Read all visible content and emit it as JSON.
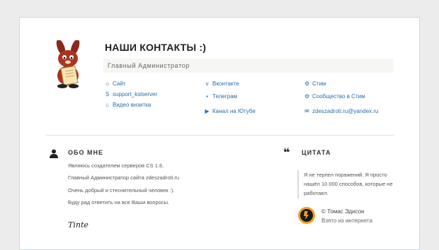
{
  "header": {
    "title": "НАШИ КОНТАКТЫ :)",
    "role": "Главный Администратор"
  },
  "links": {
    "col1": [
      {
        "label": "Сайт",
        "icon": "home-icon"
      },
      {
        "label": "support_kslserver",
        "icon": "skype-icon"
      },
      {
        "label": "Видео визитка",
        "icon": "home-icon"
      }
    ],
    "col2": [
      {
        "label": "Вконтакте",
        "icon": "vk-icon"
      },
      {
        "label": "Телеграм",
        "icon": "telegram-icon"
      },
      {
        "label": "Канал на Ютубе",
        "icon": "youtube-icon"
      }
    ],
    "col3": [
      {
        "label": "Стим",
        "icon": "steam-icon"
      },
      {
        "label": "Сообщество в Стим",
        "icon": "steam-icon"
      },
      {
        "label": "zdeszadroti.ru@yandex.ru",
        "icon": "mail-icon"
      }
    ]
  },
  "about": {
    "heading": "ОБО МНЕ",
    "lines": [
      "Являюсь создателем серверов CS 1.6.",
      "Главный Администратор сайта zdeszadroti.ru",
      "Очень добрый и стеснительный человек :).",
      "Буду рад ответить на все Ваши вопросы."
    ],
    "signature": "Tinte"
  },
  "quote": {
    "heading": "ЦИТАТА",
    "text": "Я не терпел поражений. Я просто нашёл 10 000 способов, которые не работают.",
    "author": "© Томас Эдисон",
    "source": "Взято из интернета"
  },
  "colors": {
    "link": "#2a6fa8",
    "accent": "#f0a020"
  }
}
